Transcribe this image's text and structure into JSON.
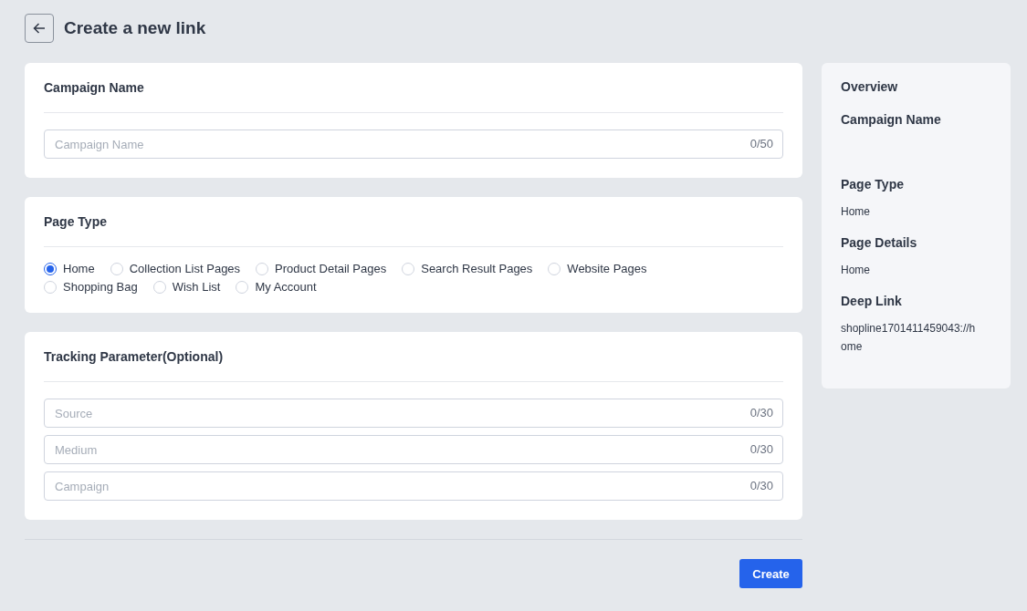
{
  "header": {
    "title": "Create a new link"
  },
  "campaign_card": {
    "title": "Campaign Name",
    "field": {
      "placeholder": "Campaign Name",
      "counter": "0/50"
    }
  },
  "page_type_card": {
    "title": "Page Type",
    "options": [
      {
        "label": "Home",
        "selected": true
      },
      {
        "label": "Collection List Pages",
        "selected": false
      },
      {
        "label": "Product Detail Pages",
        "selected": false
      },
      {
        "label": "Search Result Pages",
        "selected": false
      },
      {
        "label": "Website Pages",
        "selected": false
      },
      {
        "label": "Shopping Bag",
        "selected": false
      },
      {
        "label": "Wish List",
        "selected": false
      },
      {
        "label": "My Account",
        "selected": false
      }
    ]
  },
  "tracking_card": {
    "title": "Tracking Parameter(Optional)",
    "fields": [
      {
        "placeholder": "Source",
        "counter": "0/30"
      },
      {
        "placeholder": "Medium",
        "counter": "0/30"
      },
      {
        "placeholder": "Campaign",
        "counter": "0/30"
      }
    ]
  },
  "create_button": "Create",
  "overview": {
    "title": "Overview",
    "sections": [
      {
        "label": "Campaign Name"
      },
      {
        "label": "Page Type",
        "value": "Home"
      },
      {
        "label": "Page Details",
        "value": "Home"
      },
      {
        "label": "Deep Link",
        "value": "shopline1701411459043://home"
      }
    ]
  }
}
